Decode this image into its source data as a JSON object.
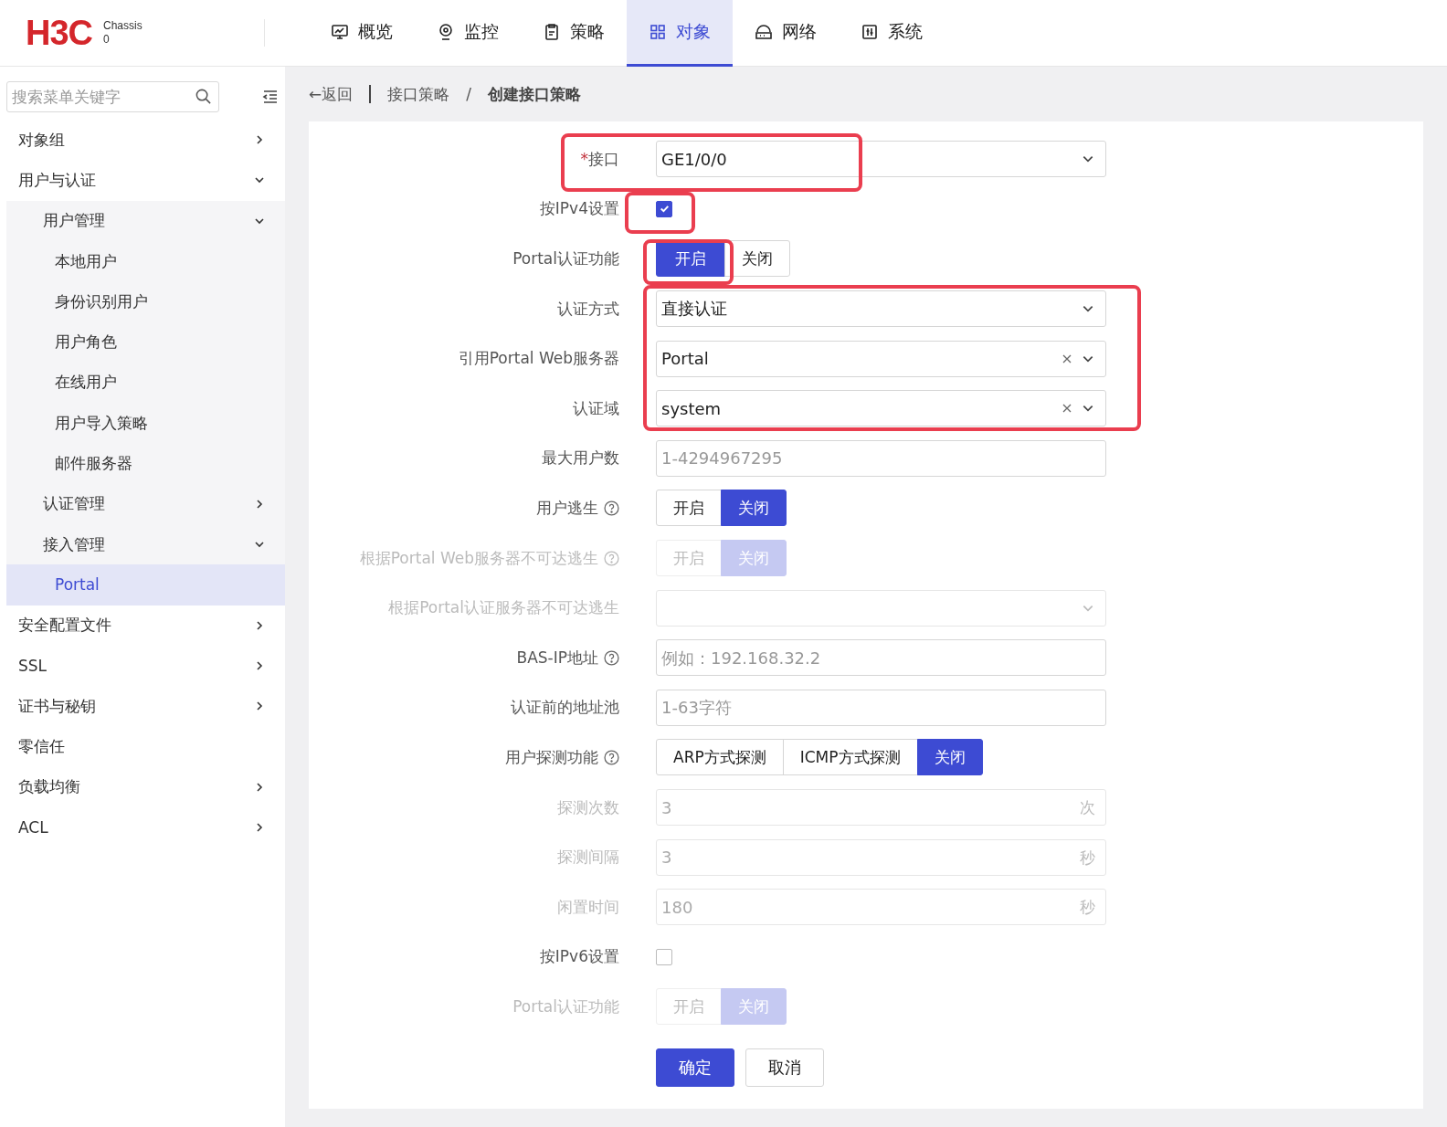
{
  "header": {
    "logo": "H3C",
    "device_name": "Chassis",
    "device_id": "0"
  },
  "nav_tabs": [
    {
      "label": "概览",
      "selected": false
    },
    {
      "label": "监控",
      "selected": false
    },
    {
      "label": "策略",
      "selected": false
    },
    {
      "label": "对象",
      "selected": true
    },
    {
      "label": "网络",
      "selected": false
    },
    {
      "label": "系统",
      "selected": false
    }
  ],
  "sidebar": {
    "search": {
      "placeholder": "搜索菜单关键字"
    },
    "items": [
      {
        "label": "对象组",
        "expanded": false,
        "selected": false
      },
      {
        "label": "用户与认证",
        "expanded": true,
        "selected": false,
        "children": [
          {
            "label": "用户管理",
            "expanded": true,
            "selected": false,
            "children": [
              {
                "label": "本地用户",
                "selected": false
              },
              {
                "label": "身份识别用户",
                "selected": false
              },
              {
                "label": "用户角色",
                "selected": false
              },
              {
                "label": "在线用户",
                "selected": false
              },
              {
                "label": "用户导入策略",
                "selected": false
              },
              {
                "label": "邮件服务器",
                "selected": false
              }
            ]
          },
          {
            "label": "认证管理",
            "expanded": false,
            "selected": false
          },
          {
            "label": "接入管理",
            "expanded": true,
            "selected": false,
            "children": [
              {
                "label": "Portal",
                "selected": true
              }
            ]
          }
        ]
      },
      {
        "label": "安全配置文件",
        "expanded": false,
        "selected": false
      },
      {
        "label": "SSL",
        "expanded": false,
        "selected": false
      },
      {
        "label": "证书与秘钥",
        "expanded": false,
        "selected": false
      },
      {
        "label": "零信任",
        "selected": false
      },
      {
        "label": "负载均衡",
        "expanded": false,
        "selected": false
      },
      {
        "label": "ACL",
        "expanded": false,
        "selected": false
      }
    ]
  },
  "breadcrumb": {
    "back": "←返回",
    "items": [
      "接口策略",
      "创建接口策略"
    ],
    "separator": "/"
  },
  "form": {
    "groups": [
      {
        "highlighted": true,
        "rows": [
          {
            "kind": "select",
            "label": "接口",
            "required_mark": "*",
            "value": "GE1/0/0",
            "clearable": false,
            "disabled": false,
            "help": false
          }
        ]
      },
      {
        "highlighted": true,
        "rows": [
          {
            "kind": "checkbox",
            "label": "按IPv4设置",
            "checked": true,
            "disabled": false,
            "help": false
          }
        ]
      },
      {
        "highlighted": true,
        "rows": [
          {
            "kind": "toggle",
            "label": "Portal认证功能",
            "disabled": false,
            "help": false,
            "options": [
              {
                "label": "开启",
                "selected": true
              },
              {
                "label": "关闭",
                "selected": false
              }
            ]
          }
        ]
      },
      {
        "highlighted": true,
        "rows": [
          {
            "kind": "select",
            "label": "认证方式",
            "value": "直接认证",
            "clearable": false,
            "disabled": false,
            "help": false
          },
          {
            "kind": "select",
            "label": "引用Portal Web服务器",
            "value": "Portal",
            "clearable": true,
            "disabled": false,
            "help": false
          },
          {
            "kind": "select",
            "label": "认证域",
            "value": "system",
            "clearable": true,
            "disabled": false,
            "help": false
          }
        ]
      },
      {
        "highlighted": false,
        "rows": [
          {
            "kind": "input",
            "label": "最大用户数",
            "placeholder": "1-4294967295",
            "disabled": false,
            "help": false
          },
          {
            "kind": "toggle",
            "label": "用户逃生",
            "disabled": false,
            "help": true,
            "options": [
              {
                "label": "开启",
                "selected": false
              },
              {
                "label": "关闭",
                "selected": true
              }
            ]
          },
          {
            "kind": "toggle",
            "label": "根据Portal Web服务器不可达逃生",
            "disabled": true,
            "help": true,
            "options": [
              {
                "label": "开启",
                "selected": false
              },
              {
                "label": "关闭",
                "selected": true
              }
            ]
          },
          {
            "kind": "select",
            "label": "根据Portal认证服务器不可达逃生",
            "clearable": false,
            "disabled": true,
            "help": false
          },
          {
            "kind": "input",
            "label": "BAS-IP地址",
            "placeholder": "例如：192.168.32.2",
            "disabled": false,
            "help": true
          },
          {
            "kind": "input",
            "label": "认证前的地址池",
            "placeholder": "1-63字符",
            "disabled": false,
            "help": false
          },
          {
            "kind": "toggle",
            "label": "用户探测功能",
            "disabled": false,
            "help": true,
            "options": [
              {
                "label": "ARP方式探测",
                "selected": false
              },
              {
                "label": "ICMP方式探测",
                "selected": false
              },
              {
                "label": "关闭",
                "selected": true
              }
            ]
          },
          {
            "kind": "input",
            "label": "探测次数",
            "value": "3",
            "suffix": "次",
            "disabled": true,
            "help": false
          },
          {
            "kind": "input",
            "label": "探测间隔",
            "value": "3",
            "suffix": "秒",
            "disabled": true,
            "help": false
          },
          {
            "kind": "input",
            "label": "闲置时间",
            "value": "180",
            "suffix": "秒",
            "disabled": true,
            "help": false
          },
          {
            "kind": "checkbox",
            "label": "按IPv6设置",
            "checked": false,
            "disabled": false,
            "help": false
          },
          {
            "kind": "toggle",
            "label": "Portal认证功能",
            "disabled": true,
            "help": false,
            "options": [
              {
                "label": "开启",
                "selected": false
              },
              {
                "label": "关闭",
                "selected": true
              }
            ]
          }
        ]
      }
    ],
    "buttons": [
      {
        "label": "确定",
        "kind": "primary"
      },
      {
        "label": "取消",
        "kind": "default"
      }
    ]
  }
}
